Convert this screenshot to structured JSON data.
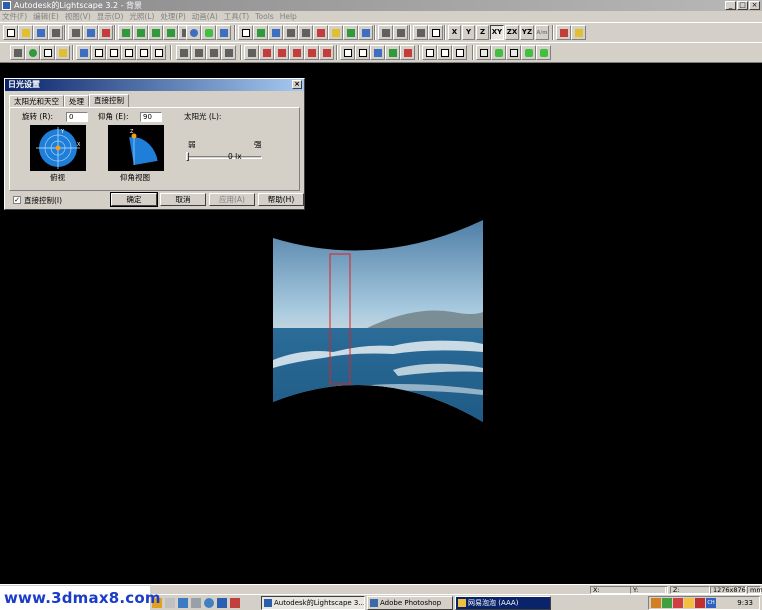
{
  "window": {
    "title": "Autodesk的Lightscape 3.2 - 背景"
  },
  "menu": [
    "文件(F)",
    "编辑(E)",
    "视图(V)",
    "显示(D)",
    "光照(L)",
    "处理(P)",
    "动画(A)",
    "工具(T)",
    "Tools",
    "Help"
  ],
  "toolbar": {
    "axis_labels": [
      "X",
      "Y",
      "Z",
      "XY",
      "ZX",
      "YZ",
      "A/m"
    ]
  },
  "dialog": {
    "title": "日光设置",
    "close": "×",
    "tabs": [
      "太阳光和天空",
      "处理",
      "直接控制"
    ],
    "rotation_label": "旋转 (R):",
    "rotation_value": "0",
    "elevation_label": "仰角 (E):",
    "elevation_value": "90",
    "sun_label": "太阳光 (L):",
    "weak": "弱",
    "strong": "强",
    "lux": "0 lx",
    "top_view_caption": "俯视",
    "elev_view_caption": "仰角视图",
    "checkbox_label": "直接控制(I)",
    "checkbox_checked": "✓",
    "buttons": {
      "ok": "确定",
      "cancel": "取消",
      "apply": "应用(A)",
      "help": "帮助(H)"
    }
  },
  "status": {
    "x_label": "X:",
    "y_label": "Y:",
    "z_label": "Z:",
    "size": "1276x876",
    "unit": "mm"
  },
  "taskbar": {
    "tasks": [
      "Autodesk的Lightscape 3....",
      "Adobe Photoshop",
      "网易泡泡 (AAA)"
    ],
    "clock": "9:33",
    "ch": "CH"
  },
  "watermark": "www.3dmax8.com",
  "colors": {
    "accent": "#0a246a",
    "watermark": "#1b3cc8",
    "selection": "#e02020"
  }
}
